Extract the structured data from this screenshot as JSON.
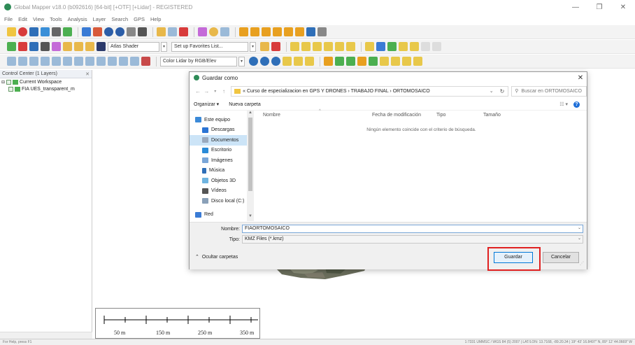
{
  "app": {
    "title": "Global Mapper v18.0 (b092616) [64-bit] [+OTF] [+Lidar] - REGISTERED",
    "window_controls": [
      "—",
      "❐",
      "✕"
    ]
  },
  "menu": [
    "File",
    "Edit",
    "View",
    "Tools",
    "Analysis",
    "Layer",
    "Search",
    "GPS",
    "Help"
  ],
  "toolbar": {
    "shader": "Atlas Shader",
    "favorites": "Set up Favorites List...",
    "lidar_color": "Color Lidar by RGB/Elev"
  },
  "control_center": {
    "title": "Control Center (1 Layers)",
    "workspace": "Current Workspace",
    "layer": "FIA UES_transparent_m"
  },
  "scale_bar": {
    "labels": [
      "50 m",
      "150 m",
      "250 m",
      "350 m"
    ]
  },
  "status_bar": {
    "left": "For Help, press F1",
    "right": "1:7331  UMMSC / WGS 84 (5) 2007 | LAT/LON: 13.7168, -89.20.34 | 19° 43' 16.8497\" N, 89° 12' 44.0669\" W"
  },
  "dialog": {
    "title": "Guardar como",
    "path": [
      "«",
      "Curso de especializacion en GPS Y DRONES",
      "›",
      "TRABAJO FINAL",
      "›",
      "ORTOMOSAICO"
    ],
    "search_placeholder": "Buscar en ORTOMOSAICO",
    "organize": "Organizar ▾",
    "new_folder": "Nueva carpeta",
    "nav_items": [
      {
        "label": "Este equipo",
        "color": "#3c8ad8"
      },
      {
        "label": "Descargas",
        "color": "#2b74d4"
      },
      {
        "label": "Documentos",
        "color": "#9aa9bd"
      },
      {
        "label": "Escritorio",
        "color": "#2b8bd8"
      },
      {
        "label": "Imágenes",
        "color": "#7aa6d8"
      },
      {
        "label": "Música",
        "color": "#2f6fb8"
      },
      {
        "label": "Objetos 3D",
        "color": "#6fb4e0"
      },
      {
        "label": "Vídeos",
        "color": "#555555"
      },
      {
        "label": "Disco local (C:)",
        "color": "#8aa0b8"
      },
      {
        "label": "Red",
        "color": "#3a7bd5"
      }
    ],
    "columns": [
      "Nombre",
      "Fecha de modificación",
      "Tipo",
      "Tamaño"
    ],
    "empty_message": "Ningún elemento coincide con el criterio de búsqueda.",
    "filename_label": "Nombre:",
    "filename_value": "FIAORTOMOSAICO",
    "type_label": "Tipo:",
    "type_value": "KMZ Files (*.kmz)",
    "hide_folders": "Ocultar carpetas",
    "save": "Guardar",
    "cancel": "Cancelar"
  },
  "colors": {
    "highlight": "#e02020",
    "selection": "#cce4f7",
    "accent": "#0078d7"
  }
}
